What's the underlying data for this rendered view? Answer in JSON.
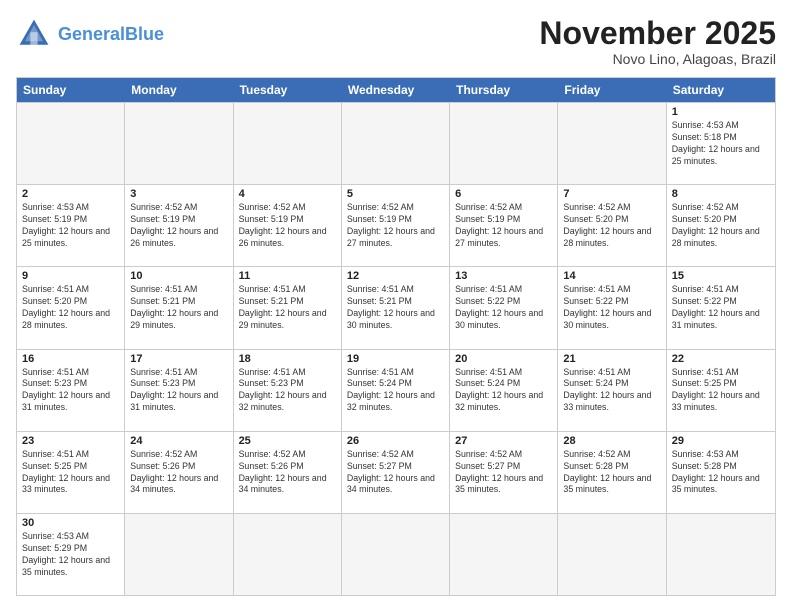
{
  "logo": {
    "text_general": "General",
    "text_blue": "Blue"
  },
  "header": {
    "month": "November 2025",
    "location": "Novo Lino, Alagoas, Brazil"
  },
  "days": [
    "Sunday",
    "Monday",
    "Tuesday",
    "Wednesday",
    "Thursday",
    "Friday",
    "Saturday"
  ],
  "weeks": [
    [
      {
        "day": "",
        "info": "",
        "empty": true
      },
      {
        "day": "",
        "info": "",
        "empty": true
      },
      {
        "day": "",
        "info": "",
        "empty": true
      },
      {
        "day": "",
        "info": "",
        "empty": true
      },
      {
        "day": "",
        "info": "",
        "empty": true
      },
      {
        "day": "",
        "info": "",
        "empty": true
      },
      {
        "day": "1",
        "info": "Sunrise: 4:53 AM\nSunset: 5:18 PM\nDaylight: 12 hours and 25 minutes."
      }
    ],
    [
      {
        "day": "2",
        "info": "Sunrise: 4:53 AM\nSunset: 5:19 PM\nDaylight: 12 hours and 25 minutes."
      },
      {
        "day": "3",
        "info": "Sunrise: 4:52 AM\nSunset: 5:19 PM\nDaylight: 12 hours and 26 minutes."
      },
      {
        "day": "4",
        "info": "Sunrise: 4:52 AM\nSunset: 5:19 PM\nDaylight: 12 hours and 26 minutes."
      },
      {
        "day": "5",
        "info": "Sunrise: 4:52 AM\nSunset: 5:19 PM\nDaylight: 12 hours and 27 minutes."
      },
      {
        "day": "6",
        "info": "Sunrise: 4:52 AM\nSunset: 5:19 PM\nDaylight: 12 hours and 27 minutes."
      },
      {
        "day": "7",
        "info": "Sunrise: 4:52 AM\nSunset: 5:20 PM\nDaylight: 12 hours and 28 minutes."
      },
      {
        "day": "8",
        "info": "Sunrise: 4:52 AM\nSunset: 5:20 PM\nDaylight: 12 hours and 28 minutes."
      }
    ],
    [
      {
        "day": "9",
        "info": "Sunrise: 4:51 AM\nSunset: 5:20 PM\nDaylight: 12 hours and 28 minutes."
      },
      {
        "day": "10",
        "info": "Sunrise: 4:51 AM\nSunset: 5:21 PM\nDaylight: 12 hours and 29 minutes."
      },
      {
        "day": "11",
        "info": "Sunrise: 4:51 AM\nSunset: 5:21 PM\nDaylight: 12 hours and 29 minutes."
      },
      {
        "day": "12",
        "info": "Sunrise: 4:51 AM\nSunset: 5:21 PM\nDaylight: 12 hours and 30 minutes."
      },
      {
        "day": "13",
        "info": "Sunrise: 4:51 AM\nSunset: 5:22 PM\nDaylight: 12 hours and 30 minutes."
      },
      {
        "day": "14",
        "info": "Sunrise: 4:51 AM\nSunset: 5:22 PM\nDaylight: 12 hours and 30 minutes."
      },
      {
        "day": "15",
        "info": "Sunrise: 4:51 AM\nSunset: 5:22 PM\nDaylight: 12 hours and 31 minutes."
      }
    ],
    [
      {
        "day": "16",
        "info": "Sunrise: 4:51 AM\nSunset: 5:23 PM\nDaylight: 12 hours and 31 minutes."
      },
      {
        "day": "17",
        "info": "Sunrise: 4:51 AM\nSunset: 5:23 PM\nDaylight: 12 hours and 31 minutes."
      },
      {
        "day": "18",
        "info": "Sunrise: 4:51 AM\nSunset: 5:23 PM\nDaylight: 12 hours and 32 minutes."
      },
      {
        "day": "19",
        "info": "Sunrise: 4:51 AM\nSunset: 5:24 PM\nDaylight: 12 hours and 32 minutes."
      },
      {
        "day": "20",
        "info": "Sunrise: 4:51 AM\nSunset: 5:24 PM\nDaylight: 12 hours and 32 minutes."
      },
      {
        "day": "21",
        "info": "Sunrise: 4:51 AM\nSunset: 5:24 PM\nDaylight: 12 hours and 33 minutes."
      },
      {
        "day": "22",
        "info": "Sunrise: 4:51 AM\nSunset: 5:25 PM\nDaylight: 12 hours and 33 minutes."
      }
    ],
    [
      {
        "day": "23",
        "info": "Sunrise: 4:51 AM\nSunset: 5:25 PM\nDaylight: 12 hours and 33 minutes."
      },
      {
        "day": "24",
        "info": "Sunrise: 4:52 AM\nSunset: 5:26 PM\nDaylight: 12 hours and 34 minutes."
      },
      {
        "day": "25",
        "info": "Sunrise: 4:52 AM\nSunset: 5:26 PM\nDaylight: 12 hours and 34 minutes."
      },
      {
        "day": "26",
        "info": "Sunrise: 4:52 AM\nSunset: 5:27 PM\nDaylight: 12 hours and 34 minutes."
      },
      {
        "day": "27",
        "info": "Sunrise: 4:52 AM\nSunset: 5:27 PM\nDaylight: 12 hours and 35 minutes."
      },
      {
        "day": "28",
        "info": "Sunrise: 4:52 AM\nSunset: 5:28 PM\nDaylight: 12 hours and 35 minutes."
      },
      {
        "day": "29",
        "info": "Sunrise: 4:53 AM\nSunset: 5:28 PM\nDaylight: 12 hours and 35 minutes."
      }
    ],
    [
      {
        "day": "30",
        "info": "Sunrise: 4:53 AM\nSunset: 5:29 PM\nDaylight: 12 hours and 35 minutes.",
        "hasData": true
      },
      {
        "day": "",
        "info": "",
        "empty": true
      },
      {
        "day": "",
        "info": "",
        "empty": true
      },
      {
        "day": "",
        "info": "",
        "empty": true
      },
      {
        "day": "",
        "info": "",
        "empty": true
      },
      {
        "day": "",
        "info": "",
        "empty": true
      },
      {
        "day": "",
        "info": "",
        "empty": true
      }
    ]
  ]
}
